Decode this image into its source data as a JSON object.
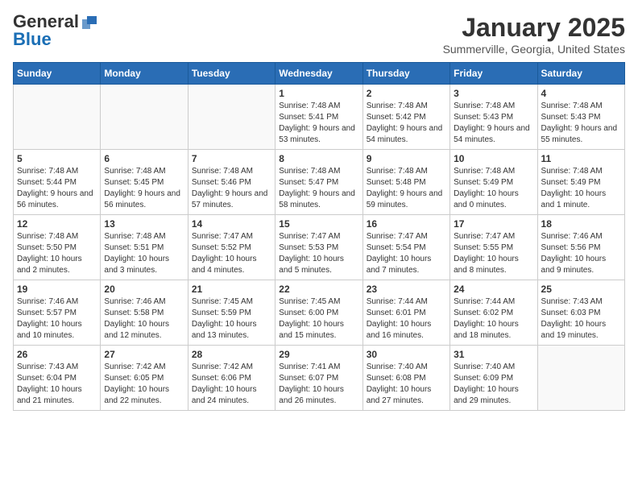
{
  "header": {
    "logo_general": "General",
    "logo_blue": "Blue",
    "month_title": "January 2025",
    "location": "Summerville, Georgia, United States"
  },
  "days_of_week": [
    "Sunday",
    "Monday",
    "Tuesday",
    "Wednesday",
    "Thursday",
    "Friday",
    "Saturday"
  ],
  "weeks": [
    [
      {
        "day": "",
        "empty": true
      },
      {
        "day": "",
        "empty": true
      },
      {
        "day": "",
        "empty": true
      },
      {
        "day": "1",
        "sunrise": "7:48 AM",
        "sunset": "5:41 PM",
        "daylight": "9 hours and 53 minutes."
      },
      {
        "day": "2",
        "sunrise": "7:48 AM",
        "sunset": "5:42 PM",
        "daylight": "9 hours and 54 minutes."
      },
      {
        "day": "3",
        "sunrise": "7:48 AM",
        "sunset": "5:43 PM",
        "daylight": "9 hours and 54 minutes."
      },
      {
        "day": "4",
        "sunrise": "7:48 AM",
        "sunset": "5:43 PM",
        "daylight": "9 hours and 55 minutes."
      }
    ],
    [
      {
        "day": "5",
        "sunrise": "7:48 AM",
        "sunset": "5:44 PM",
        "daylight": "9 hours and 56 minutes."
      },
      {
        "day": "6",
        "sunrise": "7:48 AM",
        "sunset": "5:45 PM",
        "daylight": "9 hours and 56 minutes."
      },
      {
        "day": "7",
        "sunrise": "7:48 AM",
        "sunset": "5:46 PM",
        "daylight": "9 hours and 57 minutes."
      },
      {
        "day": "8",
        "sunrise": "7:48 AM",
        "sunset": "5:47 PM",
        "daylight": "9 hours and 58 minutes."
      },
      {
        "day": "9",
        "sunrise": "7:48 AM",
        "sunset": "5:48 PM",
        "daylight": "9 hours and 59 minutes."
      },
      {
        "day": "10",
        "sunrise": "7:48 AM",
        "sunset": "5:49 PM",
        "daylight": "10 hours and 0 minutes."
      },
      {
        "day": "11",
        "sunrise": "7:48 AM",
        "sunset": "5:49 PM",
        "daylight": "10 hours and 1 minute."
      }
    ],
    [
      {
        "day": "12",
        "sunrise": "7:48 AM",
        "sunset": "5:50 PM",
        "daylight": "10 hours and 2 minutes."
      },
      {
        "day": "13",
        "sunrise": "7:48 AM",
        "sunset": "5:51 PM",
        "daylight": "10 hours and 3 minutes."
      },
      {
        "day": "14",
        "sunrise": "7:47 AM",
        "sunset": "5:52 PM",
        "daylight": "10 hours and 4 minutes."
      },
      {
        "day": "15",
        "sunrise": "7:47 AM",
        "sunset": "5:53 PM",
        "daylight": "10 hours and 5 minutes."
      },
      {
        "day": "16",
        "sunrise": "7:47 AM",
        "sunset": "5:54 PM",
        "daylight": "10 hours and 7 minutes."
      },
      {
        "day": "17",
        "sunrise": "7:47 AM",
        "sunset": "5:55 PM",
        "daylight": "10 hours and 8 minutes."
      },
      {
        "day": "18",
        "sunrise": "7:46 AM",
        "sunset": "5:56 PM",
        "daylight": "10 hours and 9 minutes."
      }
    ],
    [
      {
        "day": "19",
        "sunrise": "7:46 AM",
        "sunset": "5:57 PM",
        "daylight": "10 hours and 10 minutes."
      },
      {
        "day": "20",
        "sunrise": "7:46 AM",
        "sunset": "5:58 PM",
        "daylight": "10 hours and 12 minutes."
      },
      {
        "day": "21",
        "sunrise": "7:45 AM",
        "sunset": "5:59 PM",
        "daylight": "10 hours and 13 minutes."
      },
      {
        "day": "22",
        "sunrise": "7:45 AM",
        "sunset": "6:00 PM",
        "daylight": "10 hours and 15 minutes."
      },
      {
        "day": "23",
        "sunrise": "7:44 AM",
        "sunset": "6:01 PM",
        "daylight": "10 hours and 16 minutes."
      },
      {
        "day": "24",
        "sunrise": "7:44 AM",
        "sunset": "6:02 PM",
        "daylight": "10 hours and 18 minutes."
      },
      {
        "day": "25",
        "sunrise": "7:43 AM",
        "sunset": "6:03 PM",
        "daylight": "10 hours and 19 minutes."
      }
    ],
    [
      {
        "day": "26",
        "sunrise": "7:43 AM",
        "sunset": "6:04 PM",
        "daylight": "10 hours and 21 minutes."
      },
      {
        "day": "27",
        "sunrise": "7:42 AM",
        "sunset": "6:05 PM",
        "daylight": "10 hours and 22 minutes."
      },
      {
        "day": "28",
        "sunrise": "7:42 AM",
        "sunset": "6:06 PM",
        "daylight": "10 hours and 24 minutes."
      },
      {
        "day": "29",
        "sunrise": "7:41 AM",
        "sunset": "6:07 PM",
        "daylight": "10 hours and 26 minutes."
      },
      {
        "day": "30",
        "sunrise": "7:40 AM",
        "sunset": "6:08 PM",
        "daylight": "10 hours and 27 minutes."
      },
      {
        "day": "31",
        "sunrise": "7:40 AM",
        "sunset": "6:09 PM",
        "daylight": "10 hours and 29 minutes."
      },
      {
        "day": "",
        "empty": true
      }
    ]
  ]
}
